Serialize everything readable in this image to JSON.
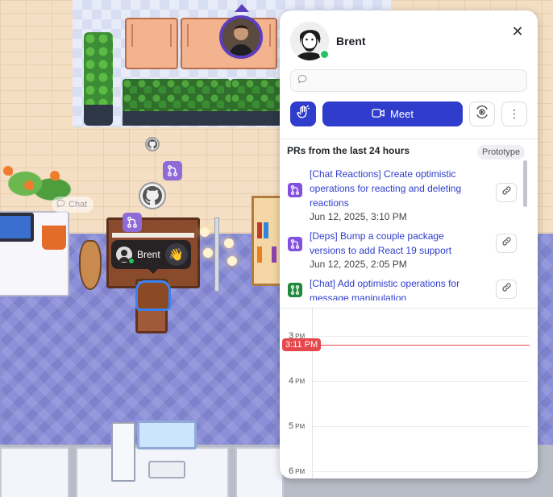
{
  "world": {
    "ghost_chat_label": "Chat",
    "local_user": {
      "name": "Brent",
      "wave_emoji": "👋"
    },
    "remote_user_icon": "person-avatar-icon",
    "pr_badge_icon": "pull-request-icon",
    "github_icon": "github-logo-icon"
  },
  "panel": {
    "profile": {
      "name": "Brent",
      "status": "online",
      "status_color": "#22c55e"
    },
    "message_input": {
      "placeholder": "",
      "value": ""
    },
    "actions": {
      "wave_icon": "wave-hand-icon",
      "meet_label": "Meet",
      "meet_icon": "video-camera-icon",
      "screen_icon": "screen-share-icon",
      "more_icon": "more-vertical-icon"
    },
    "prs": {
      "heading": "PRs from the last 24 hours",
      "badge": "Prototype",
      "items": [
        {
          "title": "[Chat Reactions] Create optimistic operations for reacting and deleting reactions",
          "date": "Jun 12, 2025, 3:10 PM",
          "icon": "pull-request-icon",
          "icon_color": "#8250df"
        },
        {
          "title": "[Deps] Bump a couple package versions to add React 19 support",
          "date": "Jun 12, 2025, 2:05 PM",
          "icon": "pull-request-icon",
          "icon_color": "#8250df"
        },
        {
          "title": "[Chat] Add optimistic operations for message manipulation",
          "date": "",
          "icon": "pull-request-open-icon",
          "icon_color": "#1f883d"
        }
      ]
    },
    "calendar": {
      "hours": [
        {
          "hour": "3",
          "ampm": "PM"
        },
        {
          "hour": "4",
          "ampm": "PM"
        },
        {
          "hour": "5",
          "ampm": "PM"
        },
        {
          "hour": "6",
          "ampm": "PM"
        }
      ],
      "now_label": "3:11 PM",
      "now_color": "#e5484d"
    }
  },
  "colors": {
    "accent": "#2f3ccc",
    "link": "#2f3ccc",
    "rug": "#8a8fd8"
  }
}
